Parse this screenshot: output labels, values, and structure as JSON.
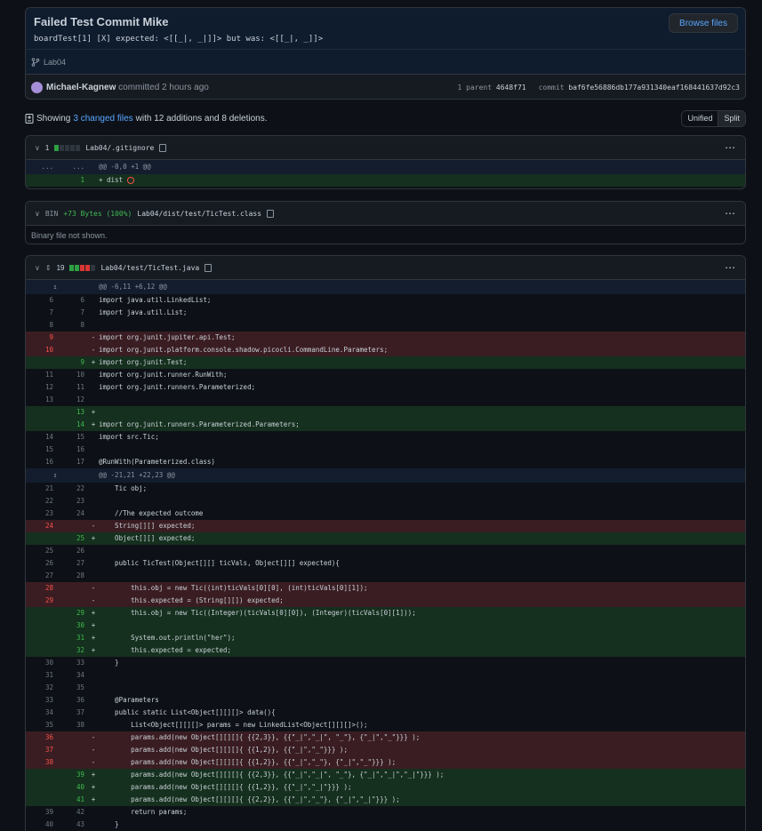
{
  "commit": {
    "title": "Failed Test Commit Mike",
    "description": "boardTest[1] [X] expected: <[[_|, _|]]> but was: <[[_|, _]]>",
    "browse_label": "Browse files",
    "branch": "Lab04",
    "author": "Michael-Kagnew",
    "action_time": "committed 2 hours ago",
    "parent_label": "1 parent",
    "parent_sha": "4648f71",
    "commit_label": "commit",
    "commit_sha": "baf6fe56886db177a931340eaf168441637d92c3"
  },
  "summary": {
    "prefix": "Showing",
    "changed": "3 changed files",
    "suffix": "with 12 additions and 8 deletions.",
    "unified": "Unified",
    "split": "Split"
  },
  "files": [
    {
      "count": "1",
      "name": "Lab04/.gitignore",
      "hunk": "@@ -0,0 +1 @@",
      "hunk_l": "...",
      "hunk_r": "...",
      "line_num": "1",
      "line_code": "+ dist"
    },
    {
      "bin": "BIN",
      "bin_add": "+73 Bytes (100%)",
      "name": "Lab04/dist/test/TicTest.class",
      "note": "Binary file not shown."
    },
    {
      "count": "19",
      "name": "Lab04/test/TicTest.java"
    }
  ],
  "diff": [
    {
      "t": "hunk",
      "a": "",
      "b": "",
      "s": "",
      "c": "@@ -6,11 +6,12 @@",
      "i": "expand-up"
    },
    {
      "t": "ctx",
      "a": "6",
      "b": "6",
      "s": "",
      "c": "import java.util.LinkedList;"
    },
    {
      "t": "ctx",
      "a": "7",
      "b": "7",
      "s": "",
      "c": "import java.util.List;"
    },
    {
      "t": "ctx",
      "a": "8",
      "b": "8",
      "s": "",
      "c": ""
    },
    {
      "t": "del",
      "a": "9",
      "b": "",
      "s": "-",
      "c": "import org.junit.jupiter.api.Test;"
    },
    {
      "t": "del",
      "a": "10",
      "b": "",
      "s": "-",
      "c": "import org.junit.platform.console.shadow.picocli.CommandLine.Parameters;"
    },
    {
      "t": "add",
      "a": "",
      "b": "9",
      "s": "+",
      "c": "import org.junit.Test;"
    },
    {
      "t": "ctx",
      "a": "11",
      "b": "10",
      "s": "",
      "c": "import org.junit.runner.RunWith;"
    },
    {
      "t": "ctx",
      "a": "12",
      "b": "11",
      "s": "",
      "c": "import org.junit.runners.Parameterized;"
    },
    {
      "t": "ctx",
      "a": "13",
      "b": "12",
      "s": "",
      "c": ""
    },
    {
      "t": "add",
      "a": "",
      "b": "13",
      "s": "+",
      "c": ""
    },
    {
      "t": "add",
      "a": "",
      "b": "14",
      "s": "+",
      "c": "import org.junit.runners.Parameterized.Parameters;"
    },
    {
      "t": "ctx",
      "a": "14",
      "b": "15",
      "s": "",
      "c": "import src.Tic;"
    },
    {
      "t": "ctx",
      "a": "15",
      "b": "16",
      "s": "",
      "c": ""
    },
    {
      "t": "ctx",
      "a": "16",
      "b": "17",
      "s": "",
      "c": "@RunWith(Parameterized.class)"
    },
    {
      "t": "hunk",
      "a": "",
      "b": "",
      "s": "",
      "c": "@@ -21,21 +22,23 @@",
      "i": "expand-both"
    },
    {
      "t": "ctx",
      "a": "21",
      "b": "22",
      "s": "",
      "c": "    Tic obj;"
    },
    {
      "t": "ctx",
      "a": "22",
      "b": "23",
      "s": "",
      "c": ""
    },
    {
      "t": "ctx",
      "a": "23",
      "b": "24",
      "s": "",
      "c": "    //The expected outcome"
    },
    {
      "t": "del",
      "a": "24",
      "b": "",
      "s": "-",
      "c": "    String[][] expected;"
    },
    {
      "t": "add",
      "a": "",
      "b": "25",
      "s": "+",
      "c": "    Object[][] expected;"
    },
    {
      "t": "ctx",
      "a": "25",
      "b": "26",
      "s": "",
      "c": ""
    },
    {
      "t": "ctx",
      "a": "26",
      "b": "27",
      "s": "",
      "c": "    public TicTest(Object[][] ticVals, Object[][] expected){"
    },
    {
      "t": "ctx",
      "a": "27",
      "b": "28",
      "s": "",
      "c": ""
    },
    {
      "t": "del",
      "a": "28",
      "b": "",
      "s": "-",
      "c": "        this.obj = new Tic((int)ticVals[0][0], (int)ticVals[0][1]);"
    },
    {
      "t": "del",
      "a": "29",
      "b": "",
      "s": "-",
      "c": "        this.expected = (String[][]) expected;"
    },
    {
      "t": "add",
      "a": "",
      "b": "29",
      "s": "+",
      "c": "        this.obj = new Tic((Integer)(ticVals[0][0]), (Integer)(ticVals[0][1]));"
    },
    {
      "t": "add",
      "a": "",
      "b": "30",
      "s": "+",
      "c": ""
    },
    {
      "t": "add",
      "a": "",
      "b": "31",
      "s": "+",
      "c": "        System.out.println(\"her\");"
    },
    {
      "t": "add",
      "a": "",
      "b": "32",
      "s": "+",
      "c": "        this.expected = expected;"
    },
    {
      "t": "ctx",
      "a": "30",
      "b": "33",
      "s": "",
      "c": "    }"
    },
    {
      "t": "ctx",
      "a": "31",
      "b": "34",
      "s": "",
      "c": ""
    },
    {
      "t": "ctx",
      "a": "32",
      "b": "35",
      "s": "",
      "c": ""
    },
    {
      "t": "ctx",
      "a": "33",
      "b": "36",
      "s": "",
      "c": "    @Parameters"
    },
    {
      "t": "ctx",
      "a": "34",
      "b": "37",
      "s": "",
      "c": "    public static List<Object[][][]> data(){"
    },
    {
      "t": "ctx",
      "a": "35",
      "b": "38",
      "s": "",
      "c": "        List<Object[][][]> params = new LinkedList<Object[][][]>();"
    },
    {
      "t": "del",
      "a": "36",
      "b": "",
      "s": "-",
      "c": "        params.add(new Object[][][]{ {{2,3}}, {{\"_|\",\"_|\", \"_\"}, {\"_|\",\"_\"}}} );"
    },
    {
      "t": "del",
      "a": "37",
      "b": "",
      "s": "-",
      "c": "        params.add(new Object[][][]{ {{1,2}}, {{\"_|\",\"_\"}}} );"
    },
    {
      "t": "del",
      "a": "38",
      "b": "",
      "s": "-",
      "c": "        params.add(new Object[][][]{ {{1,2}}, {{\"_|\",\"_\"}, {\"_|\",\"_\"}}} );"
    },
    {
      "t": "add",
      "a": "",
      "b": "39",
      "s": "+",
      "c": "        params.add(new Object[][][]{ {{2,3}}, {{\"_|\",\"_|\", \"_\"}, {\"_|\",\"_|\",\"_|\"}}} );"
    },
    {
      "t": "add",
      "a": "",
      "b": "40",
      "s": "+",
      "c": "        params.add(new Object[][][]{ {{1,2}}, {{\"_|\",\"_|\"}}} );"
    },
    {
      "t": "add",
      "a": "",
      "b": "41",
      "s": "+",
      "c": "        params.add(new Object[][][]{ {{2,2}}, {{\"_|\",\"_\"}, {\"_|\",\"_|\"}}} );"
    },
    {
      "t": "ctx",
      "a": "39",
      "b": "42",
      "s": "",
      "c": "        return params;"
    },
    {
      "t": "ctx",
      "a": "40",
      "b": "43",
      "s": "",
      "c": "    }"
    }
  ]
}
